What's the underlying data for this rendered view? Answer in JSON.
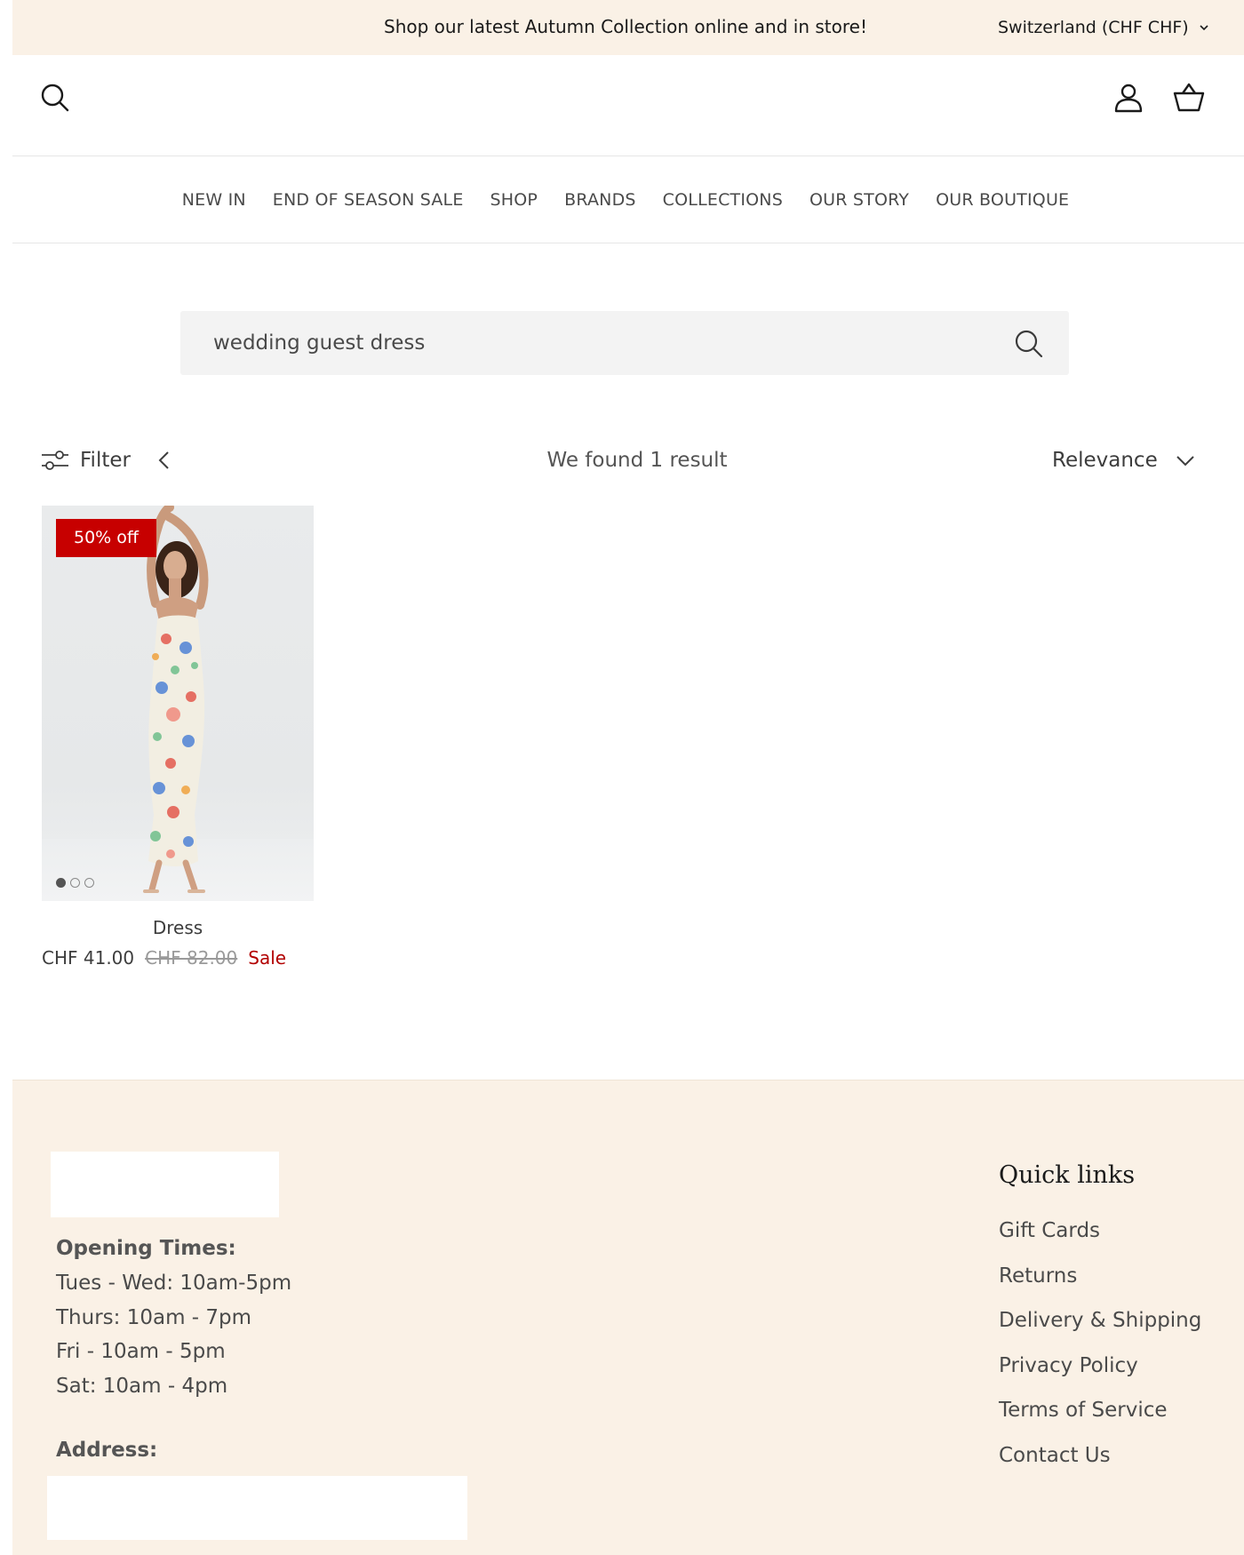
{
  "announcement": {
    "text": "Shop our latest Autumn Collection online and in store!",
    "country_label": "Switzerland (CHF CHF)"
  },
  "header": {
    "icons": [
      "search-icon",
      "account-icon",
      "basket-icon"
    ]
  },
  "nav": {
    "items": [
      {
        "label": "NEW IN"
      },
      {
        "label": "END OF SEASON SALE"
      },
      {
        "label": "SHOP"
      },
      {
        "label": "BRANDS"
      },
      {
        "label": "COLLECTIONS"
      },
      {
        "label": "OUR STORY"
      },
      {
        "label": "OUR BOUTIQUE"
      }
    ]
  },
  "search": {
    "value": "wedding guest dress"
  },
  "toolbar": {
    "filter_label": "Filter",
    "result_text": "We found 1 result",
    "sort_label": "Relevance"
  },
  "product": {
    "badge": "50% off",
    "title": "Dress",
    "price": "CHF 41.00",
    "compare_price": "CHF 82.00",
    "sale_label": "Sale",
    "image_count": 3,
    "active_image": 1
  },
  "footer": {
    "opening_title": "Opening Times:",
    "hours": [
      "Tues - Wed: 10am-5pm",
      "Thurs: 10am - 7pm",
      "Fri - 10am - 5pm",
      "Sat: 10am - 4pm"
    ],
    "address_title": "Address:",
    "quick_links_title": "Quick links",
    "quick_links": [
      "Gift Cards",
      "Returns",
      "Delivery & Shipping",
      "Privacy Policy",
      "Terms of Service",
      "Contact Us"
    ]
  },
  "colors": {
    "announcement_bg": "#faf1e6",
    "footer_bg": "#faf1e6",
    "badge_bg": "#c70000",
    "sale_text": "#b20000"
  }
}
